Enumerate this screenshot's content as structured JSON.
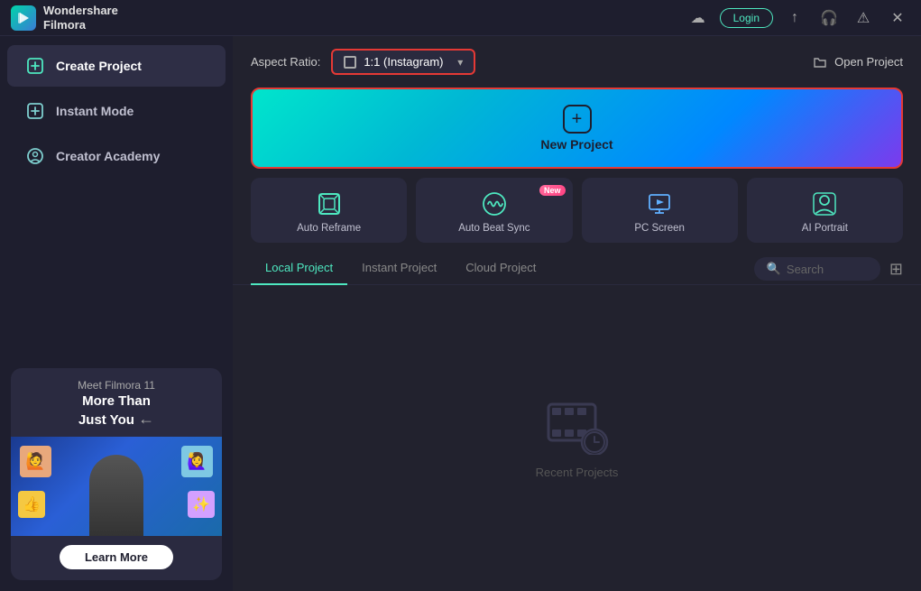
{
  "titlebar": {
    "app_name_line1": "Wondershare",
    "app_name_line2": "Filmora",
    "login_label": "Login",
    "icons": [
      "cloud",
      "upload",
      "headphone",
      "alert",
      "close"
    ]
  },
  "sidebar": {
    "items": [
      {
        "id": "create-project",
        "label": "Create Project",
        "active": true
      },
      {
        "id": "instant-mode",
        "label": "Instant Mode",
        "active": false
      },
      {
        "id": "creator-academy",
        "label": "Creator Academy",
        "active": false
      }
    ],
    "promo": {
      "tag": "Meet Filmora 11",
      "headline": "More Than\nJust You",
      "learn_more": "Learn More"
    }
  },
  "content": {
    "aspect_ratio_label": "Aspect Ratio:",
    "aspect_ratio_value": "1:1 (Instagram)",
    "open_project_label": "Open Project",
    "new_project_label": "New Project",
    "feature_cards": [
      {
        "id": "auto-reframe",
        "label": "Auto Reframe",
        "new": false
      },
      {
        "id": "auto-beat-sync",
        "label": "Auto Beat Sync",
        "new": true
      },
      {
        "id": "pc-screen",
        "label": "PC Screen",
        "new": false
      },
      {
        "id": "ai-portrait",
        "label": "AI Portrait",
        "new": false
      }
    ],
    "tabs": [
      {
        "id": "local-project",
        "label": "Local Project",
        "active": true
      },
      {
        "id": "instant-project",
        "label": "Instant Project",
        "active": false
      },
      {
        "id": "cloud-project",
        "label": "Cloud Project",
        "active": false
      }
    ],
    "search_placeholder": "Search",
    "recent_projects_label": "Recent Projects",
    "new_badge_label": "New"
  }
}
